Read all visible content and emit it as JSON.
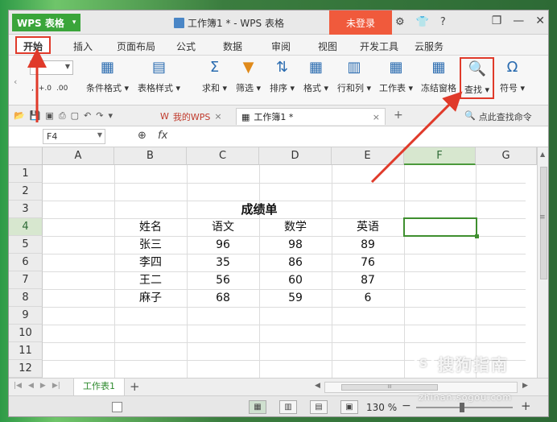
{
  "window": {
    "app_name": "WPS 表格",
    "doc_title": "工作簿1 * - WPS 表格",
    "login_label": "未登录",
    "help_label": "?",
    "minimize": "—",
    "restore": "❐",
    "close": "✕"
  },
  "menu": {
    "tabs": [
      {
        "label": "开始"
      },
      {
        "label": "插入"
      },
      {
        "label": "页面布局"
      },
      {
        "label": "公式"
      },
      {
        "label": "数据"
      },
      {
        "label": "审阅"
      },
      {
        "label": "视图"
      },
      {
        "label": "开发工具"
      },
      {
        "label": "云服务"
      }
    ]
  },
  "ribbon": {
    "buttons": [
      {
        "label": "条件格式"
      },
      {
        "label": "表格样式"
      },
      {
        "label": "求和"
      },
      {
        "label": "筛选"
      },
      {
        "label": "排序"
      },
      {
        "label": "格式"
      },
      {
        "label": "行和列"
      },
      {
        "label": "工作表"
      },
      {
        "label": "冻结窗格"
      },
      {
        "label": "查找"
      },
      {
        "label": "符号"
      }
    ]
  },
  "doc_tabs": {
    "wps_tab": "我的WPS",
    "book_tab": "工作簿1 *",
    "search_cmd": "点此查找命令"
  },
  "formula_bar": {
    "name_box": "F4",
    "fx_label": "fx",
    "formula": ""
  },
  "sheet": {
    "columns": [
      "A",
      "B",
      "C",
      "D",
      "E",
      "F",
      "G"
    ],
    "rows": [
      "1",
      "2",
      "3",
      "4",
      "5",
      "6",
      "7",
      "8",
      "9",
      "10",
      "11",
      "12"
    ],
    "title": "成绩单",
    "headers": [
      "姓名",
      "语文",
      "数学",
      "英语"
    ],
    "data": [
      [
        "张三",
        "96",
        "98",
        "89"
      ],
      [
        "李四",
        "35",
        "86",
        "76"
      ],
      [
        "王二",
        "56",
        "60",
        "87"
      ],
      [
        "麻子",
        "68",
        "59",
        "6"
      ]
    ],
    "active_cell": "F4",
    "tab_label": "工作表1",
    "scroll_grip": "III"
  },
  "status": {
    "zoom": "130 %"
  },
  "watermark": {
    "brand": "搜狗指南",
    "symbol": "S",
    "url": "zhinan.sogou.com"
  },
  "colors": {
    "accent_green": "#3aa53a",
    "login_red": "#f05a3c",
    "highlight_red": "#e03a2a"
  }
}
